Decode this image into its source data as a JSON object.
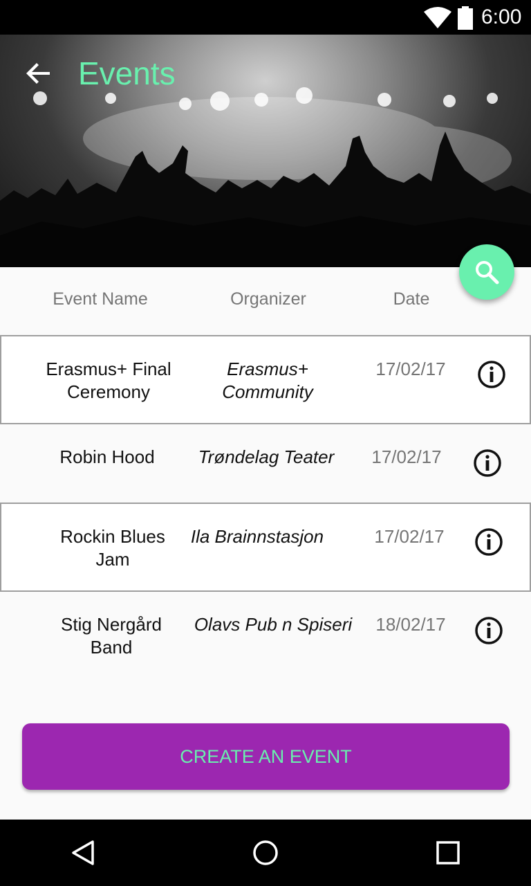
{
  "status_bar": {
    "time": "6:00"
  },
  "header": {
    "title": "Events"
  },
  "columns": {
    "event_name": "Event Name",
    "organizer": "Organizer",
    "date": "Date"
  },
  "events": [
    {
      "name_line1": "Erasmus+ Final",
      "name_line2": "Ceremony",
      "org_line1": "Erasmus+",
      "org_line2": "Community",
      "date": "17/02/17"
    },
    {
      "name_line1": "Robin Hood",
      "name_line2": "",
      "org_line1": "Trøndelag Teater",
      "org_line2": "",
      "date": "17/02/17"
    },
    {
      "name_line1": "Rockin Blues",
      "name_line2": "Jam",
      "org_line1": "Ila Brainnstasjon",
      "org_line2": "",
      "date": "17/02/17"
    },
    {
      "name_line1": "Stig Nergård",
      "name_line2": "Band",
      "org_line1": "Olavs Pub n Spiseri",
      "org_line2": "",
      "date": "18/02/17"
    }
  ],
  "create_button": {
    "label": "CREATE AN EVENT"
  },
  "colors": {
    "accent": "#69f0ae",
    "primary": "#9c27b0"
  },
  "icons": {
    "back": "arrow-back-icon",
    "search": "search-icon",
    "info": "info-icon"
  }
}
